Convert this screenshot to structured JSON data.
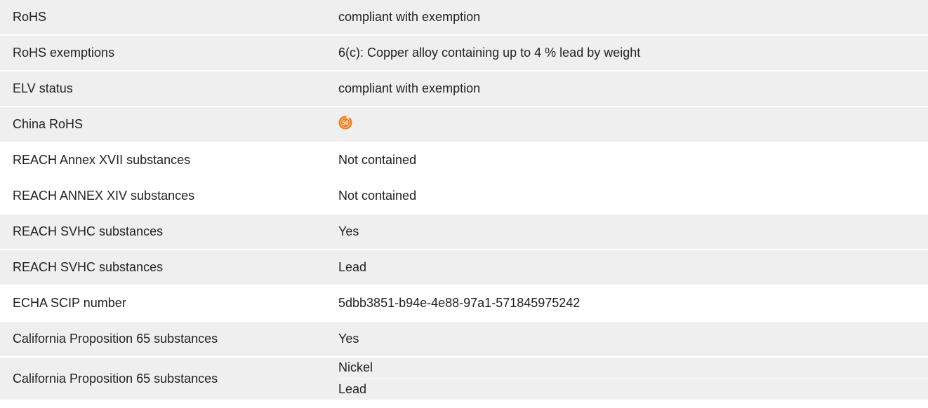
{
  "rows": [
    {
      "label": "RoHS",
      "value": "compliant with exemption"
    },
    {
      "label": "RoHS exemptions",
      "value": "6(c): Copper alloy containing up to 4 % lead by weight"
    },
    {
      "label": "ELV status",
      "value": "compliant with exemption"
    },
    {
      "label": "China RoHS",
      "icon": "china-rohs-50-icon",
      "icon_text": "50",
      "icon_color": "#f07d1a"
    },
    {
      "label": "REACH Annex XVII substances",
      "value": "Not contained"
    },
    {
      "label": "REACH ANNEX XIV substances",
      "value": "Not contained"
    },
    {
      "label": "REACH SVHC substances",
      "value": "Yes"
    },
    {
      "label": "REACH SVHC substances",
      "value": "Lead"
    },
    {
      "label": "ECHA SCIP number",
      "value": "5dbb3851-b94e-4e88-97a1-571845975242"
    },
    {
      "label": "California Proposition 65 substances",
      "value": "Yes"
    },
    {
      "label": "California Proposition 65 substances",
      "values": [
        "Nickel",
        "Lead"
      ]
    }
  ],
  "colors": {
    "row_gray": "#efefef",
    "row_white": "#ffffff",
    "text": "#222222",
    "china_rohs_orange": "#f07d1a"
  }
}
